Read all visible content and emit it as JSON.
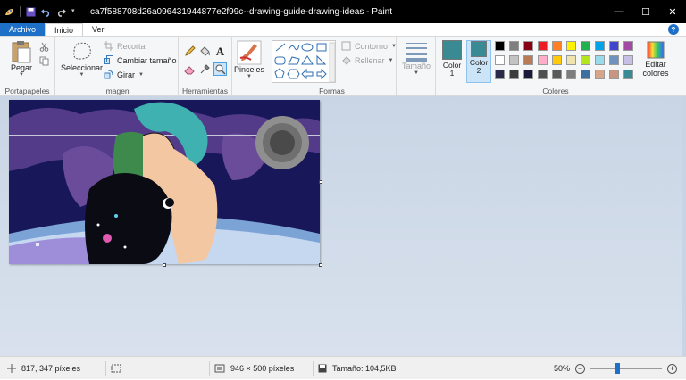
{
  "titlebar": {
    "title": "ca7f588708d26a096431944877e2f99c--drawing-guide-drawing-ideas - Paint",
    "minimize": "—",
    "maximize": "☐",
    "close": "✕"
  },
  "tabs": [
    {
      "label": "Archivo"
    },
    {
      "label": "Inicio"
    },
    {
      "label": "Ver"
    }
  ],
  "help_label": "?",
  "ribbon": {
    "clipboard": {
      "paste": "Pegar",
      "group": "Portapapeles"
    },
    "image": {
      "select": "Seleccionar",
      "crop": "Recortar",
      "resize": "Cambiar tamaño",
      "rotate": "Girar",
      "group": "Imagen"
    },
    "tools": {
      "group": "Herramientas",
      "text_tool": "A"
    },
    "brushes": {
      "label": "Pinceles"
    },
    "shapes": {
      "outline": "Contorno",
      "fill": "Rellenar",
      "group": "Formas"
    },
    "size": {
      "label": "Tamaño"
    },
    "colors": {
      "color1": {
        "label": "Color",
        "num": "1",
        "hex": "#3a8a93"
      },
      "color2": {
        "label": "Color",
        "num": "2",
        "hex": "#3a8a93"
      },
      "edit": "Editar colores",
      "group": "Colores",
      "palette": [
        "#000000",
        "#7f7f7f",
        "#880015",
        "#ed1c24",
        "#ff7f27",
        "#fff200",
        "#22b14c",
        "#00a2e8",
        "#3f48cc",
        "#a349a4",
        "#ffffff",
        "#c3c3c3",
        "#b97a57",
        "#ffaec9",
        "#ffc90e",
        "#efe4b0",
        "#b5e61d",
        "#99d9ea",
        "#7092be",
        "#c8bfe7",
        "#2a2a4a",
        "#3b3b3b",
        "#1a1a3a",
        "#4f4f4f",
        "#5a5a5a",
        "#7d7d7d",
        "#3d6fa0",
        "#d9a58a",
        "#c89680",
        "#3a8a93"
      ]
    }
  },
  "statusbar": {
    "cursor_pos": "817, 347 píxeles",
    "image_size": "946 × 500 píxeles",
    "file_size": "Tamaño: 104,5KB",
    "zoom": "50%",
    "zoom_out": "−",
    "zoom_in": "+"
  }
}
